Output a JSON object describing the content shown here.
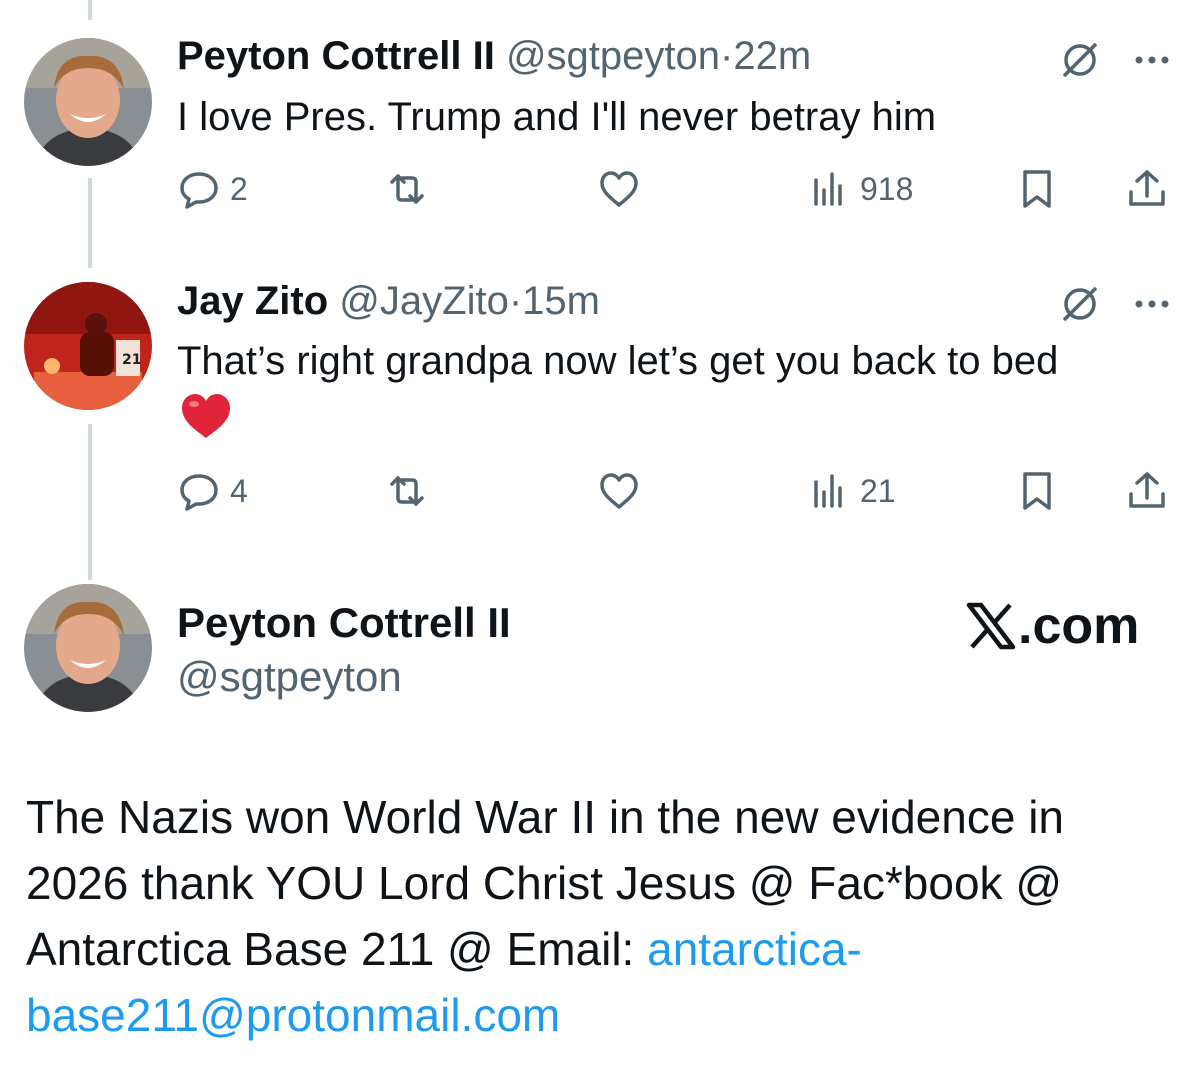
{
  "thread": [
    {
      "name": "Peyton Cottrell II",
      "handle": "@sgtpeyton",
      "sep": "·",
      "time": "22m",
      "text": "I love Pres. Trump and I'll never betray him",
      "replies": "2",
      "reposts": "",
      "likes": "",
      "views": "918",
      "avatar_bg": "#8a8f94"
    },
    {
      "name": "Jay Zito",
      "handle": "@JayZito",
      "sep": "·",
      "time": "15m",
      "text": "That’s right grandpa now let’s get you back to bed",
      "replies": "4",
      "reposts": "",
      "likes": "",
      "views": "21",
      "avatar_bg": "#c0251b"
    }
  ],
  "card": {
    "name": "Peyton Cottrell II",
    "handle": "@sgtpeyton",
    "brand_suffix": ".com",
    "post_text": "The Nazis won World War II in the new evidence in 2026 thank YOU Lord Christ Jesus @ Fac*book @ Antarctica Base 211 @ Email: ",
    "post_link_part1": "antarctica-",
    "post_link_part2": "base211@protonmail.com"
  },
  "icons": {
    "reply": "reply-icon",
    "repost": "repost-icon",
    "like": "heart-icon",
    "views": "views-icon",
    "bookmark": "bookmark-icon",
    "share": "share-icon",
    "grok": "grok-icon",
    "more": "more-icon",
    "emoji": "red-heart-emoji",
    "brand": "x-logo-icon"
  },
  "colors": {
    "text": "#0f1419",
    "muted": "#536471",
    "link": "#1d9bf0",
    "thread_line": "#cfd9de",
    "heart_emoji": "#e0243a"
  }
}
